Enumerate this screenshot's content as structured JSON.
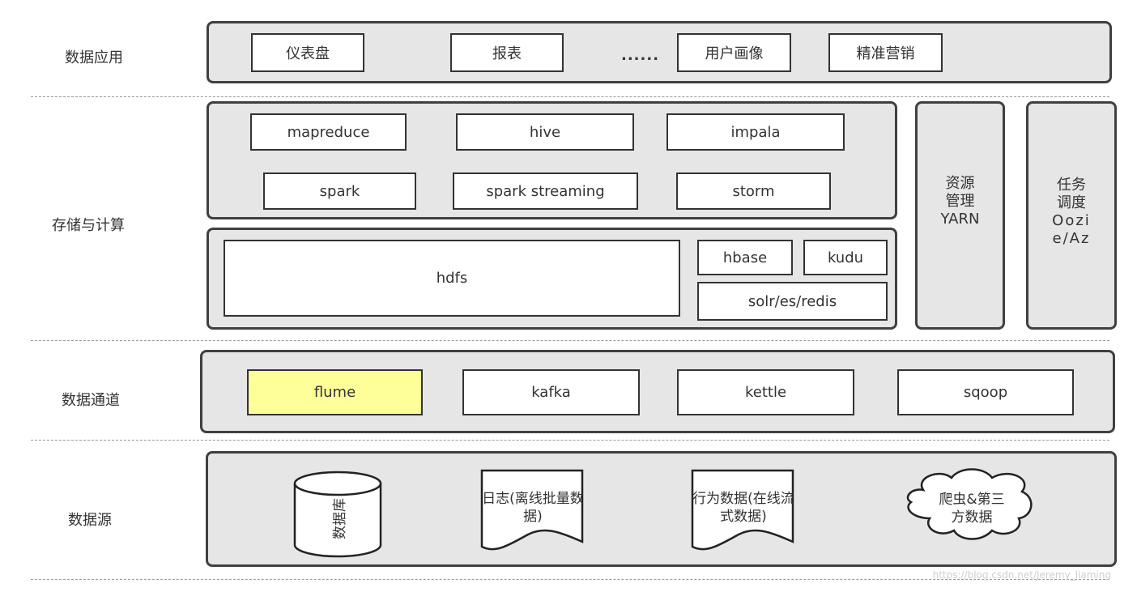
{
  "layers": {
    "application": {
      "label": "数据应用",
      "items": [
        "仪表盘",
        "报表",
        "用户画像",
        "精准营销"
      ],
      "ellipsis": "......"
    },
    "storage_compute": {
      "label": "存储与计算",
      "compute": [
        "mapreduce",
        "hive",
        "impala",
        "spark",
        "spark streaming",
        "storm"
      ],
      "storage": {
        "hdfs": "hdfs",
        "hbase": "hbase",
        "kudu": "kudu",
        "search": "solr/es/redis"
      },
      "resource": [
        "资源",
        "管理",
        "YARN"
      ],
      "scheduler": [
        "任务",
        "调度",
        "Oozi",
        "e/Az"
      ]
    },
    "channel": {
      "label": "数据通道",
      "items": [
        "flume",
        "kafka",
        "kettle",
        "sqoop"
      ],
      "highlight_color": "#ffff99"
    },
    "source": {
      "label": "数据源",
      "database": "数据库",
      "log": [
        "日志(离线批量数",
        "据)"
      ],
      "behavior": [
        "行为数据(在线流",
        "式数据)"
      ],
      "crawler": [
        "爬虫&第三",
        "方数据"
      ]
    }
  },
  "watermark": "https://blog.csdn.net/Jeremy_liaming"
}
